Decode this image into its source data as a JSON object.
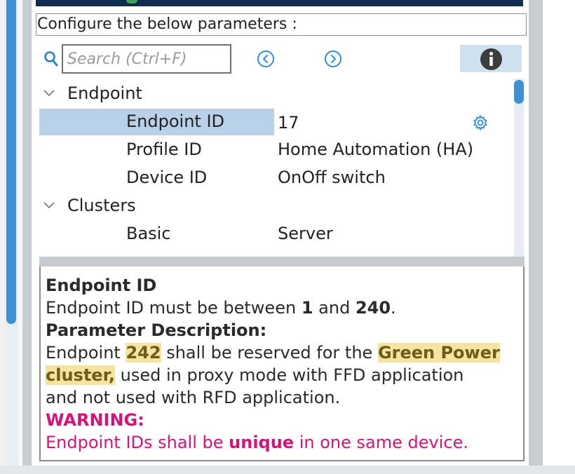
{
  "configure_label": "Configure the below parameters :",
  "search": {
    "placeholder": "Search (Ctrl+F)"
  },
  "tree": {
    "groups": [
      {
        "label": "Endpoint"
      },
      {
        "label": "Clusters"
      }
    ],
    "rows": [
      {
        "name": "Endpoint ID",
        "value": "17"
      },
      {
        "name": "Profile ID",
        "value": "Home Automation (HA)"
      },
      {
        "name": "Device ID",
        "value": "OnOff switch"
      },
      {
        "name": "Basic",
        "value": "Server"
      }
    ]
  },
  "description": {
    "title": "Endpoint ID",
    "range_prefix": "Endpoint ID must be between ",
    "range_min": "1",
    "range_and": " and ",
    "range_max": "240",
    "range_suffix": ".",
    "param_heading": "Parameter Description:",
    "line1_a": "Endpoint ",
    "line1_num": "242",
    "line1_b": " shall be reserved for the ",
    "line1_hl": "Green Power",
    "line2_hl": "cluster,",
    "line2_b": " used in proxy mode with FFD application",
    "line3": "and not used with RFD application.",
    "warning_heading": "WARNING:",
    "warning_a": "Endpoint IDs shall be ",
    "warning_bold": "unique",
    "warning_b": " in one same device."
  },
  "colors": {
    "accent": "#3d8fd6",
    "selection": "#b8d0e8",
    "warning": "#d4147b",
    "highlight": "#f5de8c",
    "header_bar": "#0f2c4e"
  },
  "icons": [
    "search-icon",
    "previous-icon",
    "next-icon",
    "info-icon",
    "gear-icon",
    "chevron-down-icon"
  ]
}
